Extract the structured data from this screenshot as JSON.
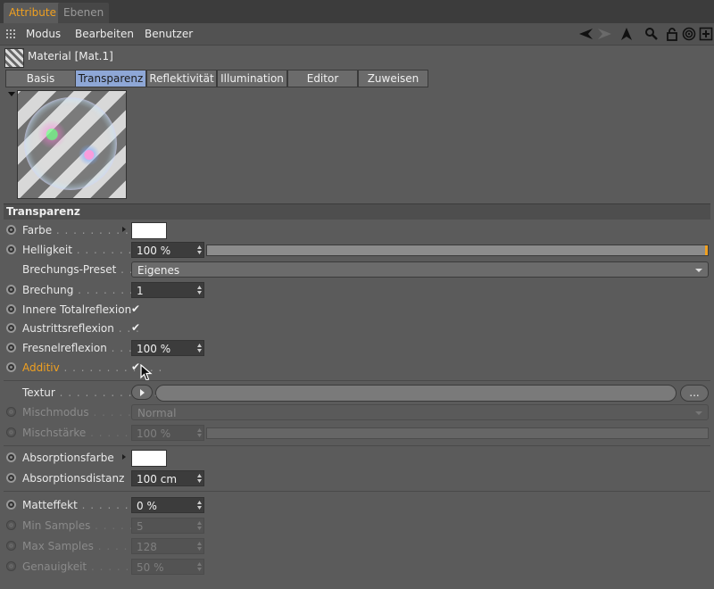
{
  "tabs": [
    {
      "label": "Attribute",
      "active": true
    },
    {
      "label": "Ebenen",
      "active": false
    }
  ],
  "menu": {
    "items": [
      "Modus",
      "Bearbeiten",
      "Benutzer"
    ]
  },
  "material": {
    "title": "Material [Mat.1]"
  },
  "subtabs": [
    {
      "label": "Basis",
      "active": false
    },
    {
      "label": "Transparenz",
      "active": true
    },
    {
      "label": "Reflektivität",
      "active": false
    },
    {
      "label": "Illumination",
      "active": false
    },
    {
      "label": "Editor",
      "active": false
    },
    {
      "label": "Zuweisen",
      "active": false
    }
  ],
  "section": {
    "title": "Transparenz"
  },
  "params": {
    "farbe": {
      "label": "Farbe",
      "dots": " . . . . . . . . . . .",
      "color": "#ffffff"
    },
    "helligkeit": {
      "label": "Helligkeit",
      "dots": " . . . . . . . . .",
      "value": "100 %",
      "fraction": 1.0
    },
    "brechungs_preset": {
      "label": "Brechungs-Preset",
      "dots": " . .",
      "value": "Eigenes"
    },
    "brechung": {
      "label": "Brechung",
      "dots": " . . . . . . . . . .",
      "value": "1"
    },
    "innere_totalreflexion": {
      "label": "Innere Totalreflexion",
      "checked": true
    },
    "austrittsreflexion": {
      "label": "Austrittsreflexion",
      "dots": " . . .",
      "checked": true
    },
    "fresnelreflexion": {
      "label": "Fresnelreflexion",
      "dots": " . . . .",
      "value": "100 %"
    },
    "additiv": {
      "label": "Additiv",
      "dots": " . . . . . . . . . . . .",
      "checked": true
    },
    "textur": {
      "label": "Textur",
      "dots": " . . . . . . . . . . . . .",
      "more": "..."
    },
    "mischmodus": {
      "label": "Mischmodus",
      "dots": " . . . . . . .",
      "value": "Normal"
    },
    "mischstaerke": {
      "label": "Mischstärke",
      "dots": " . . . . . . .",
      "value": "100 %"
    },
    "absorptionsfarbe": {
      "label": "Absorptionsfarbe",
      "color": "#ffffff"
    },
    "absorptionsdistanz": {
      "label": "Absorptionsdistanz",
      "value": "100 cm"
    },
    "matteffekt": {
      "label": "Matteffekt",
      "dots": " . . . . . . . . .",
      "value": "0 %"
    },
    "min_samples": {
      "label": "Min Samples",
      "dots": " . . . . . .",
      "value": "5"
    },
    "max_samples": {
      "label": "Max Samples",
      "dots": " . . . . . .",
      "value": "128"
    },
    "genauigkeit": {
      "label": "Genauigkeit",
      "dots": " . . . . . . .",
      "value": "50 %"
    }
  },
  "colors": {
    "accent": "#f0a020",
    "active_tab": "#8ea7d6"
  }
}
